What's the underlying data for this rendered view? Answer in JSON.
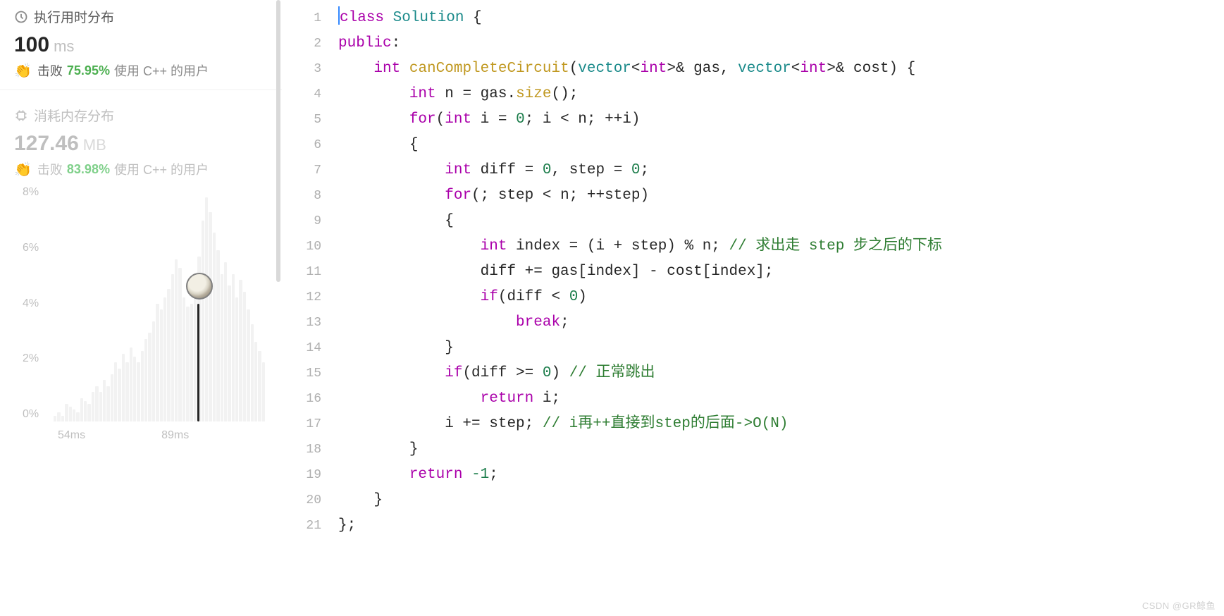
{
  "stats": {
    "runtime": {
      "title": "执行用时分布",
      "value": "100",
      "unit": "ms",
      "beats_label": "击败",
      "beats_pct": "75.95%",
      "beats_suffix": "使用 C++ 的用户",
      "clap_icon": "👏"
    },
    "memory": {
      "title": "消耗内存分布",
      "value": "127.46",
      "unit": "MB",
      "beats_label": "击败",
      "beats_pct": "83.98%",
      "beats_suffix": "使用 C++ 的用户",
      "clap_icon": "👏"
    }
  },
  "chart_data": {
    "type": "bar",
    "title": "",
    "xlabel": "ms",
    "ylabel": "%",
    "ylim": [
      0,
      8
    ],
    "x_ticks": [
      "54ms",
      "89ms"
    ],
    "y_ticks": [
      "8%",
      "6%",
      "4%",
      "2%",
      "0%"
    ],
    "marker_value_ms": 100,
    "values": [
      0.2,
      0.3,
      0.2,
      0.6,
      0.5,
      0.4,
      0.3,
      0.8,
      0.7,
      0.6,
      1.0,
      1.2,
      1.0,
      1.4,
      1.2,
      1.6,
      2.0,
      1.8,
      2.3,
      2.0,
      2.5,
      2.2,
      2.0,
      2.4,
      2.8,
      3.0,
      3.4,
      4.0,
      3.8,
      4.2,
      4.5,
      5.0,
      5.5,
      5.2,
      4.2,
      3.9,
      4.0,
      4.8,
      5.6,
      6.8,
      7.6,
      7.1,
      6.4,
      5.8,
      5.0,
      5.4,
      4.6,
      5.0,
      4.2,
      4.8,
      4.4,
      3.8,
      3.3,
      2.7,
      2.4,
      2.0
    ]
  },
  "code": {
    "lines": 21,
    "source": [
      {
        "indent": 0,
        "tokens": [
          {
            "c": "k",
            "t": "class"
          },
          {
            "c": "",
            "t": " "
          },
          {
            "c": "t",
            "t": "Solution"
          },
          {
            "c": "",
            "t": " {"
          }
        ]
      },
      {
        "indent": 0,
        "tokens": [
          {
            "c": "k",
            "t": "public"
          },
          {
            "c": "",
            "t": ":"
          }
        ]
      },
      {
        "indent": 1,
        "tokens": [
          {
            "c": "k",
            "t": "int"
          },
          {
            "c": "",
            "t": " "
          },
          {
            "c": "fn",
            "t": "canCompleteCircuit"
          },
          {
            "c": "",
            "t": "("
          },
          {
            "c": "t",
            "t": "vector"
          },
          {
            "c": "",
            "t": "<"
          },
          {
            "c": "k",
            "t": "int"
          },
          {
            "c": "",
            "t": ">& gas, "
          },
          {
            "c": "t",
            "t": "vector"
          },
          {
            "c": "",
            "t": "<"
          },
          {
            "c": "k",
            "t": "int"
          },
          {
            "c": "",
            "t": ">& cost) {"
          }
        ]
      },
      {
        "indent": 2,
        "tokens": [
          {
            "c": "k",
            "t": "int"
          },
          {
            "c": "",
            "t": " n = gas."
          },
          {
            "c": "fn",
            "t": "size"
          },
          {
            "c": "",
            "t": "();"
          }
        ]
      },
      {
        "indent": 2,
        "tokens": [
          {
            "c": "k",
            "t": "for"
          },
          {
            "c": "",
            "t": "("
          },
          {
            "c": "k",
            "t": "int"
          },
          {
            "c": "",
            "t": " i = "
          },
          {
            "c": "n",
            "t": "0"
          },
          {
            "c": "",
            "t": "; i < n; ++i)"
          }
        ]
      },
      {
        "indent": 2,
        "tokens": [
          {
            "c": "",
            "t": "{"
          }
        ]
      },
      {
        "indent": 3,
        "tokens": [
          {
            "c": "k",
            "t": "int"
          },
          {
            "c": "",
            "t": " diff = "
          },
          {
            "c": "n",
            "t": "0"
          },
          {
            "c": "",
            "t": ", step = "
          },
          {
            "c": "n",
            "t": "0"
          },
          {
            "c": "",
            "t": ";"
          }
        ]
      },
      {
        "indent": 3,
        "tokens": [
          {
            "c": "k",
            "t": "for"
          },
          {
            "c": "",
            "t": "(; step < n; ++step)"
          }
        ]
      },
      {
        "indent": 3,
        "tokens": [
          {
            "c": "",
            "t": "{"
          }
        ]
      },
      {
        "indent": 4,
        "tokens": [
          {
            "c": "k",
            "t": "int"
          },
          {
            "c": "",
            "t": " index = (i + step) % n; "
          },
          {
            "c": "cm",
            "t": "// 求出走 step 步之后的下标"
          }
        ]
      },
      {
        "indent": 4,
        "tokens": [
          {
            "c": "",
            "t": "diff += gas[index] - cost[index];"
          }
        ]
      },
      {
        "indent": 4,
        "tokens": [
          {
            "c": "k",
            "t": "if"
          },
          {
            "c": "",
            "t": "(diff < "
          },
          {
            "c": "n",
            "t": "0"
          },
          {
            "c": "",
            "t": ")"
          }
        ]
      },
      {
        "indent": 5,
        "tokens": [
          {
            "c": "k",
            "t": "break"
          },
          {
            "c": "",
            "t": ";"
          }
        ]
      },
      {
        "indent": 3,
        "tokens": [
          {
            "c": "",
            "t": "}"
          }
        ]
      },
      {
        "indent": 3,
        "tokens": [
          {
            "c": "k",
            "t": "if"
          },
          {
            "c": "",
            "t": "(diff >= "
          },
          {
            "c": "n",
            "t": "0"
          },
          {
            "c": "",
            "t": ") "
          },
          {
            "c": "cm",
            "t": "// 正常跳出"
          }
        ]
      },
      {
        "indent": 4,
        "tokens": [
          {
            "c": "k",
            "t": "return"
          },
          {
            "c": "",
            "t": " i;"
          }
        ]
      },
      {
        "indent": 3,
        "tokens": [
          {
            "c": "",
            "t": "i += step; "
          },
          {
            "c": "cm",
            "t": "// i再++直接到step的后面->O(N)"
          }
        ]
      },
      {
        "indent": 2,
        "tokens": [
          {
            "c": "",
            "t": "}"
          }
        ]
      },
      {
        "indent": 2,
        "tokens": [
          {
            "c": "k",
            "t": "return"
          },
          {
            "c": "",
            "t": " "
          },
          {
            "c": "n",
            "t": "-1"
          },
          {
            "c": "",
            "t": ";"
          }
        ]
      },
      {
        "indent": 1,
        "tokens": [
          {
            "c": "",
            "t": "}"
          }
        ]
      },
      {
        "indent": 0,
        "tokens": [
          {
            "c": "",
            "t": "};"
          }
        ]
      }
    ]
  },
  "watermark": "CSDN @GR鲸鱼"
}
